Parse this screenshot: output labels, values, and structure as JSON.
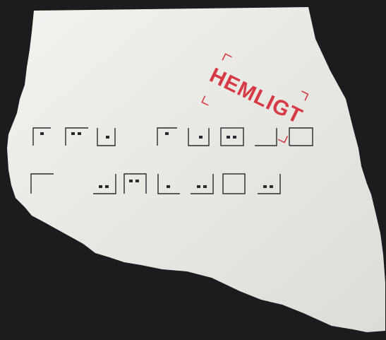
{
  "photo": {
    "background_color": "#1c1c1e",
    "paper_color": "#e9e9e6",
    "ink_color": "#2a2a2a"
  },
  "stamp": {
    "text": "HEMLIGT",
    "color": "#d63a44"
  },
  "cipher": {
    "rows": [
      [
        "pen-dot1",
        "pen-dot2",
        "pen-dot1-u",
        "gap",
        "pen-dot1",
        "pen-dot1-u",
        "box-dot2",
        "pen-flat",
        "pen-flat2"
      ],
      [
        "corner-tl",
        "gap",
        "gap",
        "pen-dot2-j",
        "box-dot2-top",
        "pen-dot1-l",
        "pen-dot2-j",
        "box-empty",
        "pen-dot2-j"
      ]
    ]
  }
}
